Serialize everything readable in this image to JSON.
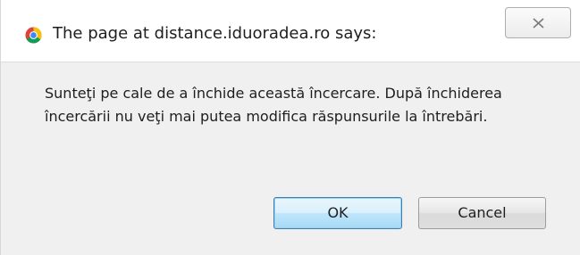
{
  "dialog": {
    "title": "The page at distance.iduoradea.ro says:",
    "message": "Sunteţi pe cale de a închide această încercare. După închiderea încercării nu veţi mai putea modifica răspunsurile la întrebări.",
    "buttons": {
      "ok_label": "OK",
      "cancel_label": "Cancel"
    },
    "icons": {
      "browser": "chrome-icon",
      "close": "close-icon"
    }
  }
}
